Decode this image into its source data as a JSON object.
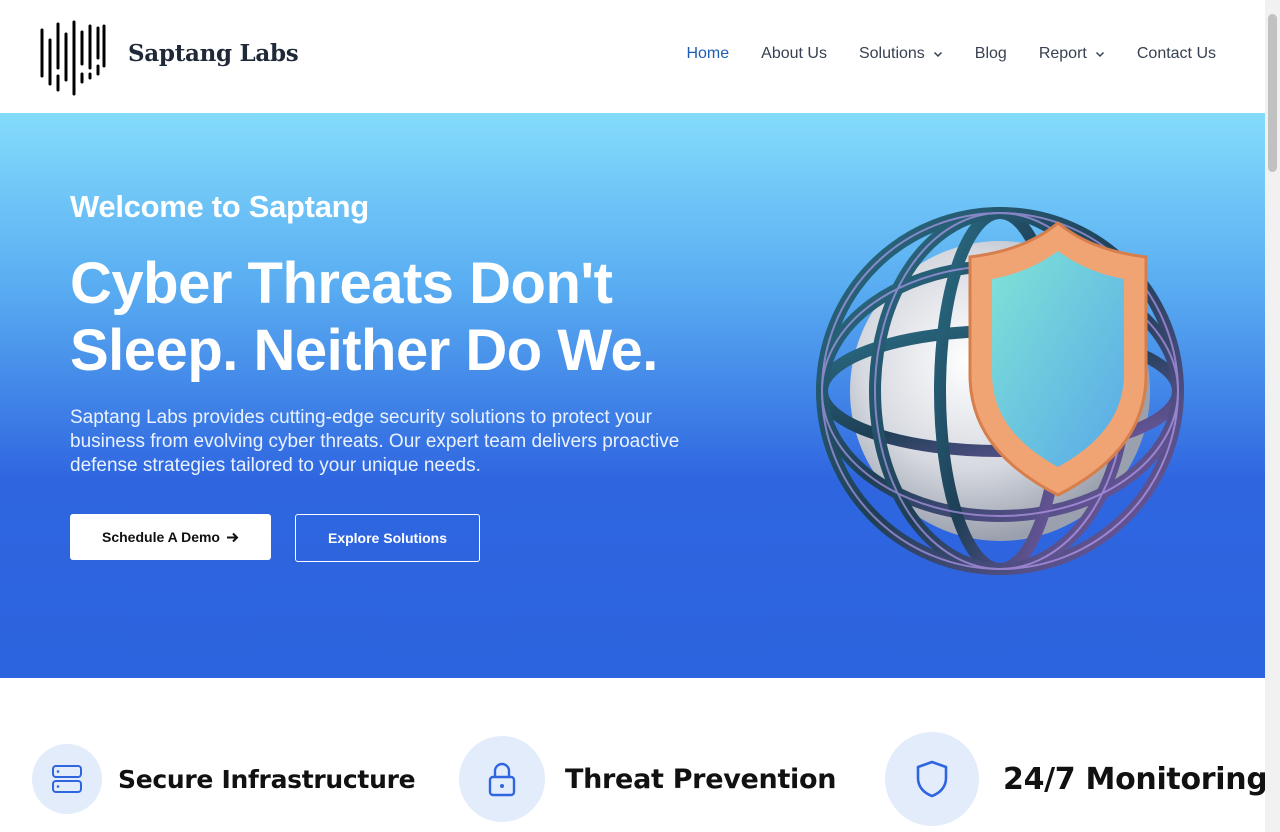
{
  "brand": {
    "name": "Saptang Labs",
    "logo_icon": "barcode-logo"
  },
  "nav": {
    "items": [
      {
        "label": "Home",
        "active": true
      },
      {
        "label": "About Us"
      },
      {
        "label": "Solutions",
        "has_dropdown": true
      },
      {
        "label": "Blog"
      },
      {
        "label": "Report",
        "has_dropdown": true
      },
      {
        "label": "Contact Us"
      }
    ],
    "active_color": "#1d5fb3"
  },
  "hero": {
    "welcome": "Welcome to Saptang",
    "headline_line1": "Cyber Threats Don't",
    "headline_line2": "Sleep. Neither Do We.",
    "description": "Saptang Labs provides cutting-edge security solutions to protect your business from evolving cyber threats. Our expert team delivers proactive defense strategies tailored to your unique needs.",
    "primary_button": "Schedule A Demo",
    "secondary_button": "Explore Solutions",
    "illustration": "globe-shield-icon"
  },
  "features": [
    {
      "title": "Secure Infrastructure",
      "icon": "server-icon"
    },
    {
      "title": "Threat Prevention",
      "icon": "lock-icon"
    },
    {
      "title": "24/7 Monitoring",
      "icon": "shield-icon"
    }
  ],
  "colors": {
    "hero_top": "#84dcfb",
    "hero_bottom": "#2c63de",
    "accent": "#2f66e0"
  }
}
